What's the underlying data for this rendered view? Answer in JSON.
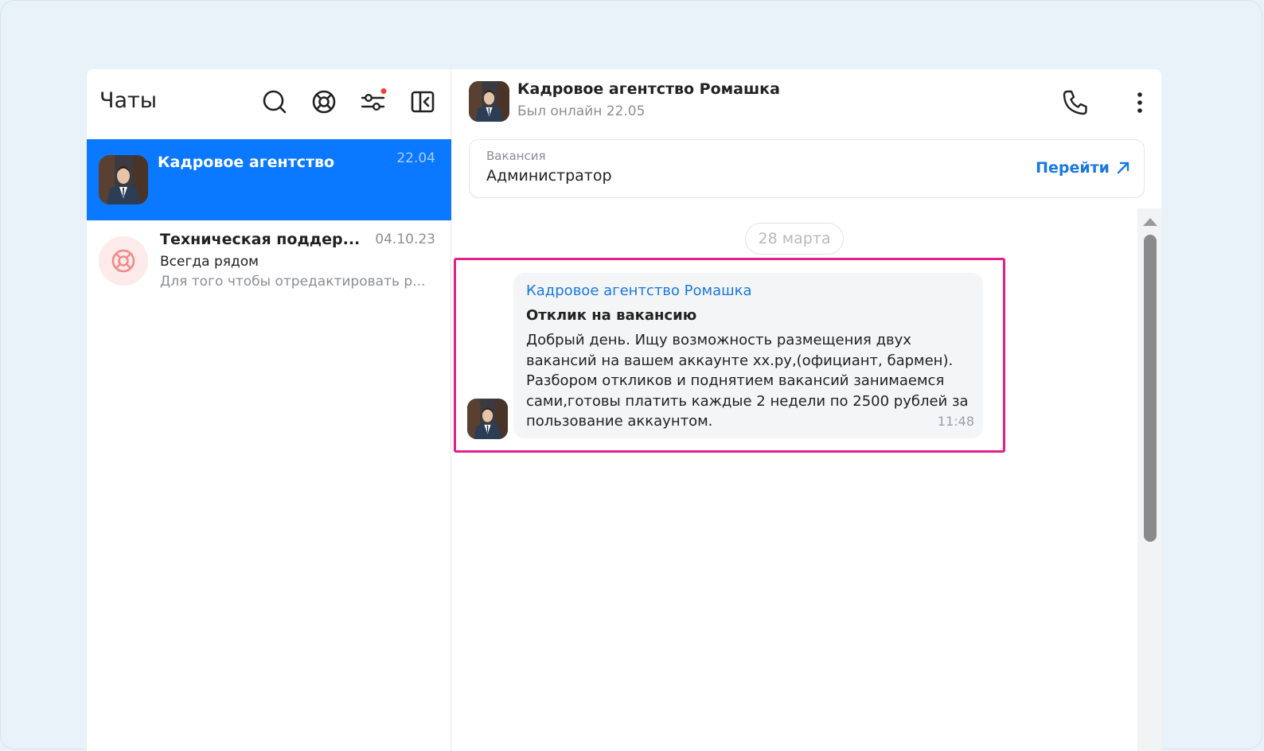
{
  "sidebar": {
    "title": "Чаты",
    "icons": [
      "search-icon",
      "support-icon",
      "filter-icon",
      "collapse-panel-icon"
    ],
    "chats": [
      {
        "name": "Кадровое агентство",
        "date": "22.04",
        "active": true
      },
      {
        "name": "Техническая поддер...",
        "date": "04.10.23",
        "subtitle": "Всегда рядом",
        "preview": "Для того чтобы отредактировать р..."
      }
    ]
  },
  "chat_header": {
    "name": "Кадровое агентство Ромашка",
    "status": "Был онлайн 22.05",
    "icons": [
      "phone-icon",
      "more-vertical-icon"
    ]
  },
  "vacancy": {
    "label": "Вакансия",
    "value": "Администратор",
    "action": "Перейти"
  },
  "messages": {
    "date_separator": "28 марта",
    "items": [
      {
        "author": "Кадровое агентство Ромашка",
        "subject": "Отклик на вакансию",
        "text": "Добрый день. Ищу возможность размещения двух вакансий на вашем аккаунте хх.ру,(официант, бармен). Разбором откликов и поднятием вакансий занимаемся сами,готовы платить каждые 2 недели по 2500 рублей за пользование аккаунтом.",
        "time": "11:48"
      }
    ]
  },
  "colors": {
    "accent": "#0a78ff",
    "link": "#1a78e0",
    "highlight": "#e0218a",
    "background": "#e8f2f8"
  }
}
